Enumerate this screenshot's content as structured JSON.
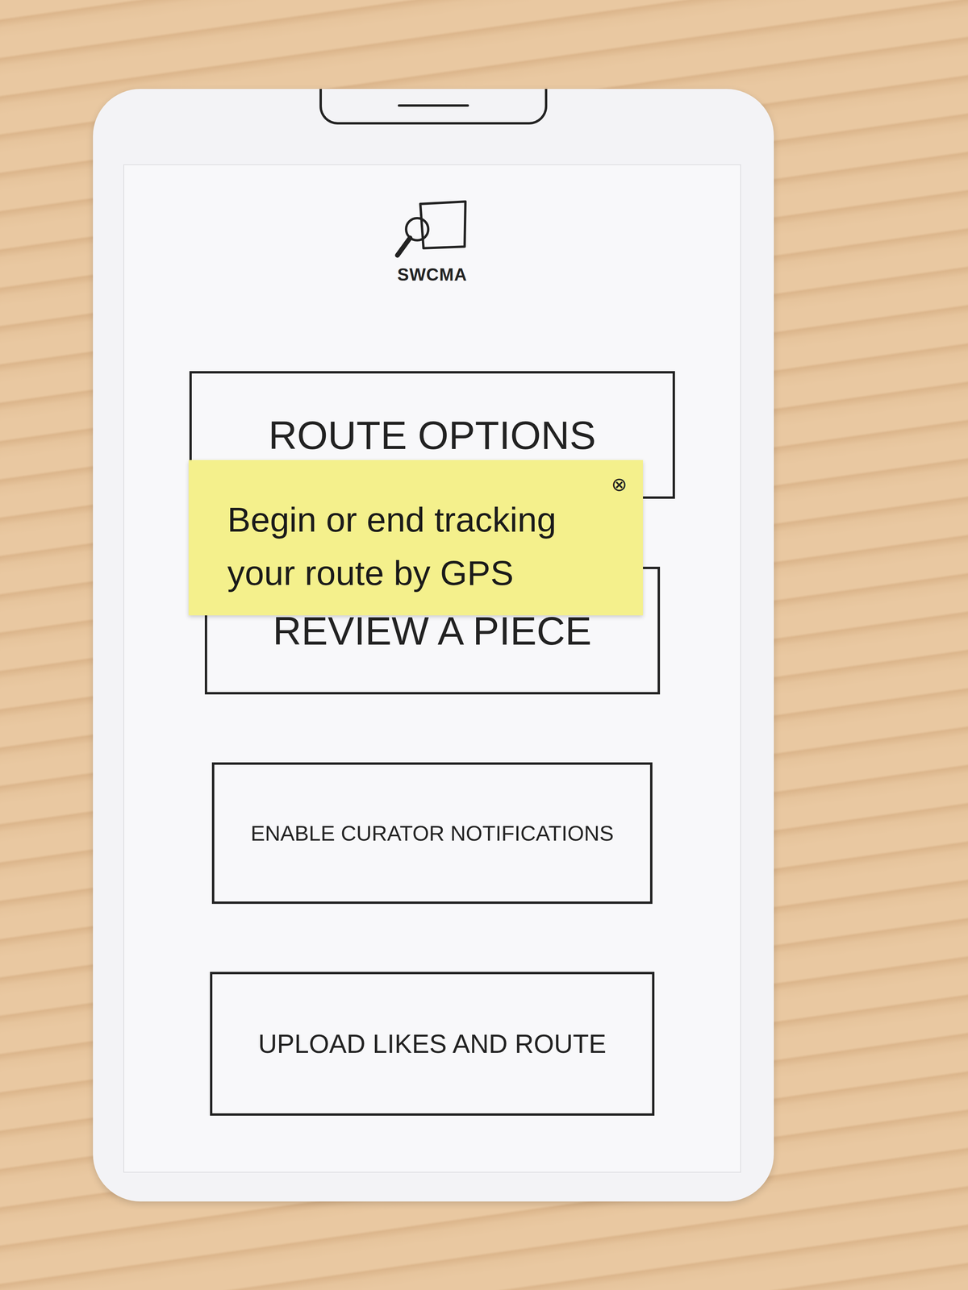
{
  "app": {
    "logo_text": "SWCMA"
  },
  "menu": [
    {
      "label": "ROUTE OPTIONS"
    },
    {
      "label": "REVIEW A PIECE"
    },
    {
      "label": "ENABLE CURATOR NOTIFICATIONS"
    },
    {
      "label": "UPLOAD LIKES AND ROUTE"
    }
  ],
  "tooltip": {
    "lines": [
      "Begin or end tracking",
      "your route by GPS"
    ],
    "close": "⊗"
  }
}
